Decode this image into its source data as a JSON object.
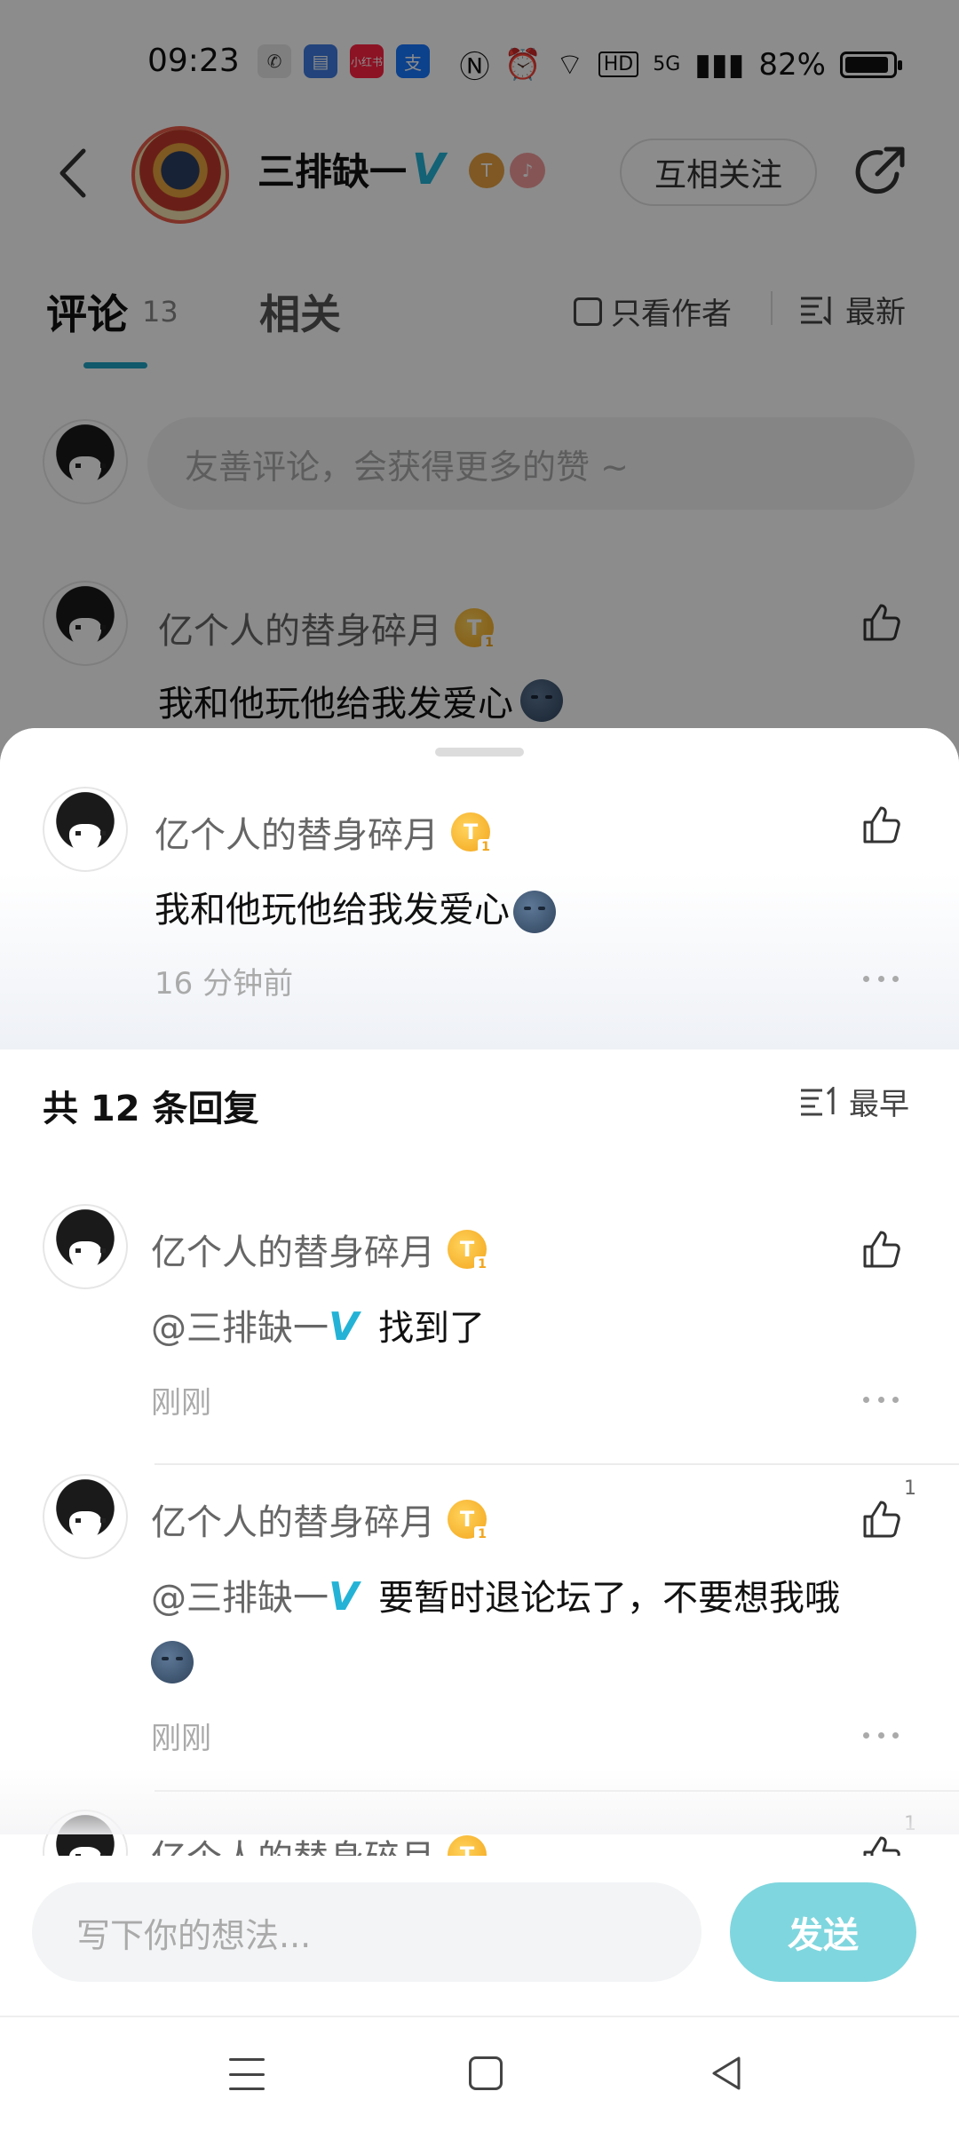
{
  "status_bar": {
    "time": "09:23",
    "apps": [
      {
        "name": "wechat-icon",
        "color": "#ffffff",
        "glyph": "✆"
      },
      {
        "name": "card-app-icon",
        "color": "#4a90e2",
        "glyph": "▤"
      },
      {
        "name": "xiaohongshu-icon",
        "color": "#ff2442",
        "glyph": "小红书"
      },
      {
        "name": "alipay-icon",
        "color": "#1677ff",
        "glyph": "支"
      }
    ],
    "network": "5G",
    "battery_text": "82%",
    "battery_level": 0.82
  },
  "header": {
    "author_name": "三排缺一",
    "follow_label": "互相关注"
  },
  "tabs": {
    "comment_label": "评论",
    "comment_count": "13",
    "related_label": "相关",
    "only_author_label": "只看作者",
    "sort_label": "最新"
  },
  "comment_input": {
    "placeholder": "友善评论，会获得更多的赞 ~"
  },
  "background_comment": {
    "user": "亿个人的替身碎月",
    "badge": "T",
    "text": "我和他玩他给我发爱心"
  },
  "sheet": {
    "main_comment": {
      "user": "亿个人的替身碎月",
      "badge": "T",
      "text": "我和他玩他给我发爱心",
      "time": "16 分钟前"
    },
    "replies_header": "共 12 条回复",
    "sort_label": "最早",
    "replies": [
      {
        "user": "亿个人的替身碎月",
        "badge": "T",
        "mention": "@三排缺一",
        "text": "找到了",
        "time": "刚刚",
        "likes": ""
      },
      {
        "user": "亿个人的替身碎月",
        "badge": "T",
        "mention": "@三排缺一",
        "text": "要暂时退论坛了，不要想我哦",
        "time": "刚刚",
        "likes": "1"
      },
      {
        "user": "亿个人的替身碎月",
        "badge": "T",
        "likes": "1"
      }
    ],
    "reply_input_placeholder": "写下你的想法...",
    "send_label": "发送"
  },
  "colors": {
    "accent": "#1fa3c4",
    "verified": "#24b3d6",
    "send_button": "#7fd6de"
  }
}
